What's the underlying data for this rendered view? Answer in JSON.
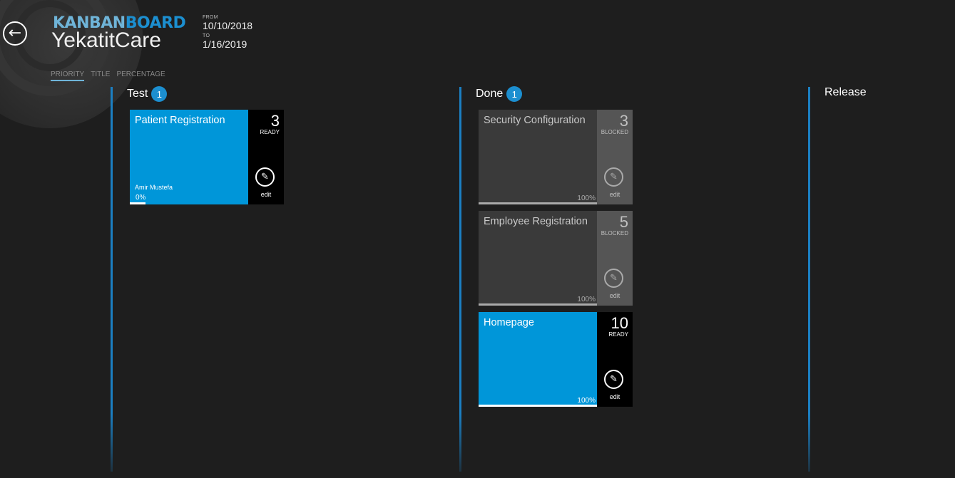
{
  "header": {
    "back_icon": "arrow-left-circle-icon",
    "logo_part1": "KANBAN",
    "logo_part2": "BOARD",
    "project_name": "YekatitCare",
    "from_label": "FROM",
    "from_date": "10/10/2018",
    "to_label": "TO",
    "to_date": "1/16/2019"
  },
  "sort_tabs": [
    {
      "label": "PRIORITY",
      "active": true
    },
    {
      "label": "TITLE",
      "active": false
    },
    {
      "label": "PERCENTAGE",
      "active": false
    }
  ],
  "columns": [
    {
      "name": "Test",
      "count": "1",
      "cards": [
        {
          "title": "Patient Registration",
          "assignee": "Amir Mustefa",
          "percent_label": "0%",
          "progress": 0.0,
          "number": "3",
          "state": "READY",
          "edit_label": "edit"
        }
      ]
    },
    {
      "name": "Done",
      "count": "1",
      "cards": [
        {
          "title": "Security Configuration",
          "assignee": "",
          "percent_label": "100%",
          "progress": 1.0,
          "number": "3",
          "state": "BLOCKED",
          "edit_label": "edit"
        },
        {
          "title": "Employee Registration",
          "assignee": "",
          "percent_label": "100%",
          "progress": 1.0,
          "number": "5",
          "state": "BLOCKED",
          "edit_label": "edit"
        },
        {
          "title": "Homepage",
          "assignee": "",
          "percent_label": "100%",
          "progress": 1.0,
          "number": "10",
          "state": "READY",
          "edit_label": "edit"
        }
      ]
    },
    {
      "name": "Release",
      "count": "",
      "cards": []
    }
  ],
  "colors": {
    "accent": "#1c8fd0",
    "ready_card": "#0096d9",
    "blocked_card": "#3a3a3a",
    "background": "#1e1e1e"
  }
}
